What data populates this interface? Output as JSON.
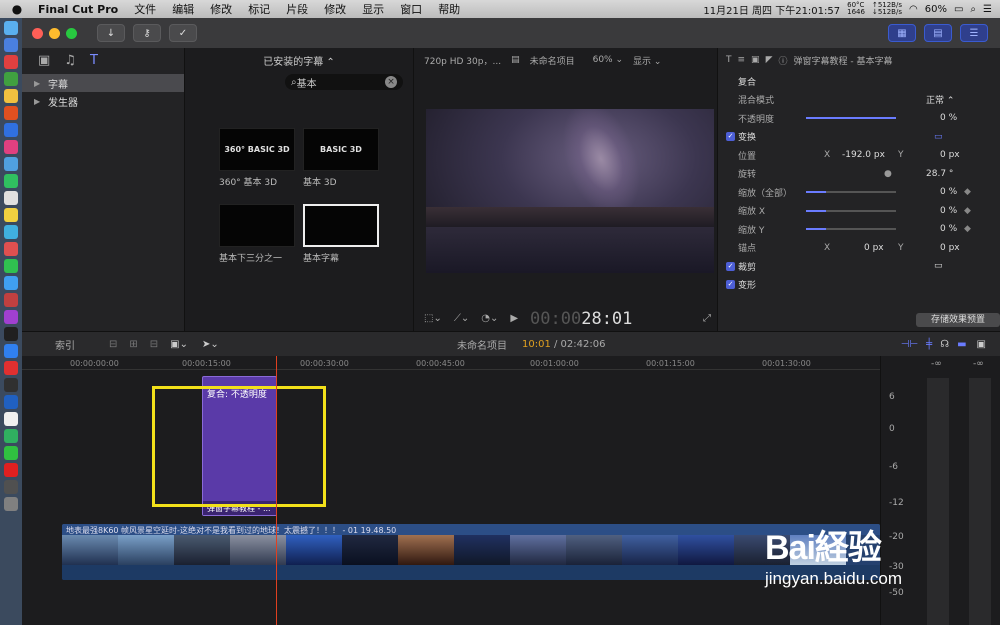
{
  "menubar": {
    "app": "Final Cut Pro",
    "items": [
      "文件",
      "编辑",
      "修改",
      "标记",
      "片段",
      "修改",
      "显示",
      "窗口",
      "帮助"
    ],
    "datetime": "11月21日 周四 下午21:01:57",
    "cpu_temp": "60°C",
    "fan": "1646",
    "net_up": "↑512B/s",
    "net_down": "↓512B/s",
    "battery": "60%"
  },
  "library": {
    "items": [
      {
        "label": "字幕",
        "selected": true
      },
      {
        "label": "发生器",
        "selected": false
      }
    ]
  },
  "browser": {
    "installed": "已安装的字幕 ⌃",
    "search_value": "基本",
    "thumbs": [
      {
        "text": "360° BASIC 3D",
        "caption": "360° 基本 3D"
      },
      {
        "text": "BASIC 3D",
        "caption": "基本 3D"
      },
      {
        "text": "",
        "caption": "基本下三分之一"
      },
      {
        "text": "",
        "caption": "基本字幕"
      }
    ]
  },
  "viewer": {
    "format": "720p HD 30p，...",
    "project": "未命名项目",
    "zoom": "60% ⌄",
    "display": "显示 ⌄",
    "timecode_dim": "00:00",
    "timecode": "28:01"
  },
  "inspector": {
    "title": "弹窗字幕教程 - 基本字幕",
    "composite": "复合",
    "blend_label": "混合模式",
    "blend_value": "正常 ⌃",
    "opacity_label": "不透明度",
    "opacity_value": "0 %",
    "transform": "变换",
    "position_label": "位置",
    "pos_x_label": "X",
    "pos_x": "-192.0 px",
    "pos_y_label": "Y",
    "pos_y": "0 px",
    "rotation_label": "旋转",
    "rotation": "28.7 °",
    "scale_all_label": "缩放（全部）",
    "scale_all": "0 %",
    "scale_x_label": "缩放 X",
    "scale_x": "0 %",
    "scale_y_label": "缩放 Y",
    "scale_y": "0 %",
    "anchor_label": "锚点",
    "anchor_x": "0 px",
    "anchor_y": "0 px",
    "crop": "裁剪",
    "distort": "变形",
    "save_preset": "存储效果预置"
  },
  "timeline": {
    "index": "索引",
    "project": "未命名项目",
    "time": "10:01",
    "duration": " / 02:42:06",
    "ruler": [
      "00:00:00:00",
      "00:00:15:00",
      "00:00:30:00",
      "00:00:45:00",
      "00:01:00:00",
      "00:01:15:00",
      "00:01:30:00"
    ],
    "title_clip_top": "复合: 不透明度",
    "title_clip_name": "弹窗字幕教程 - ...",
    "main_clip_name": "地表最强8K60 帧风景星空延时-这绝对不是我看到过的地球！太震撼了！！！ - 01 19.48.50"
  },
  "meters": {
    "labels": [
      "6",
      "0",
      "-6",
      "-12",
      "-20",
      "-30",
      "-50"
    ],
    "top": "-∞"
  },
  "watermark": {
    "logo": "Bai経验",
    "url": "jingyan.baidu.com"
  }
}
